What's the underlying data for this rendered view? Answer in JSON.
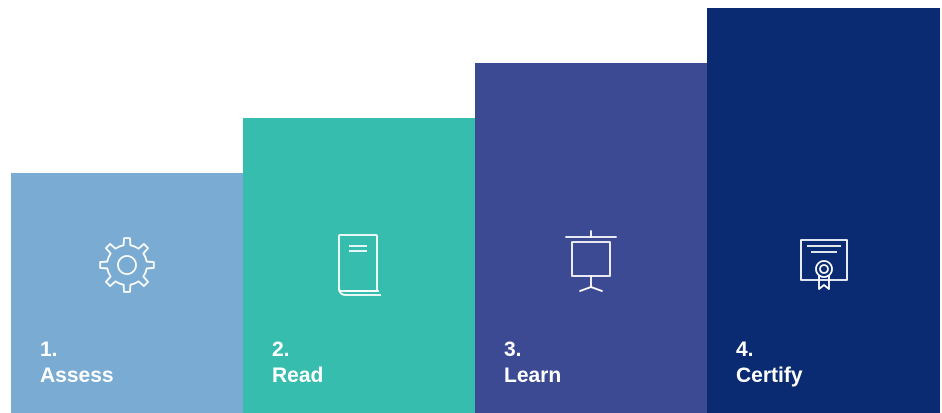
{
  "steps": [
    {
      "number": "1.",
      "label": "Assess",
      "color": "#7aabd3",
      "icon": "gear-icon"
    },
    {
      "number": "2.",
      "label": "Read",
      "color": "#37bdad",
      "icon": "book-icon"
    },
    {
      "number": "3.",
      "label": "Learn",
      "color": "#3c4993",
      "icon": "presentation-board-icon"
    },
    {
      "number": "4.",
      "label": "Certify",
      "color": "#0a2b71",
      "icon": "certificate-icon"
    }
  ]
}
